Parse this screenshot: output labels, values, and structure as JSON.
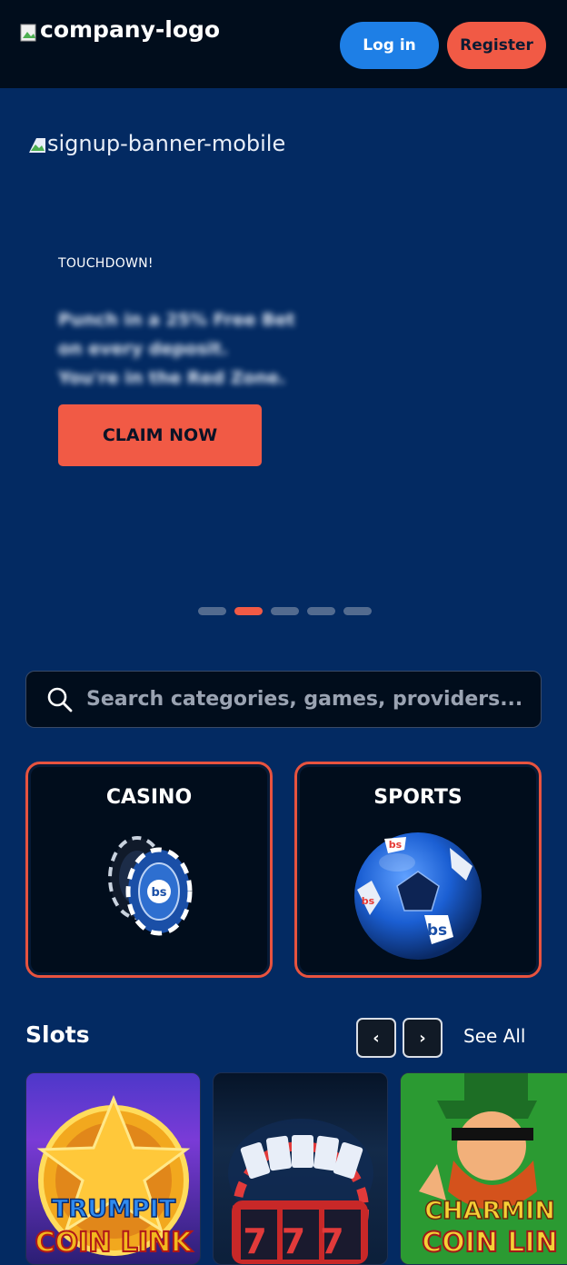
{
  "header": {
    "logo_alt": "company-logo",
    "login_label": "Log in",
    "register_label": "Register"
  },
  "banner": {
    "image_alt": "signup-banner-mobile",
    "eyebrow": "TOUCHDOWN!",
    "body_lines": [
      "Punch in a 25% Free Bet",
      "on every deposit.",
      "You're in the Red Zone."
    ],
    "cta_label": "CLAIM NOW",
    "slide_count": 5,
    "active_slide": 2
  },
  "search": {
    "placeholder": "Search categories, games, providers..."
  },
  "categories": [
    {
      "label": "CASINO",
      "icon": "casino-chips-icon"
    },
    {
      "label": "SPORTS",
      "icon": "soccer-ball-icon"
    }
  ],
  "slots": {
    "title": "Slots",
    "see_all_label": "See All",
    "games": [
      {
        "title_line1": "TRUMPIT",
        "title_line2": "COIN LINK"
      },
      {
        "title_line1": "777",
        "title_line2": ""
      },
      {
        "title_line1": "CHARMIN",
        "title_line2": "COIN LIN"
      }
    ]
  },
  "colors": {
    "background": "#032a62",
    "header": "#010d1c",
    "accent_red": "#f15a45",
    "accent_blue": "#1e7fe6"
  }
}
